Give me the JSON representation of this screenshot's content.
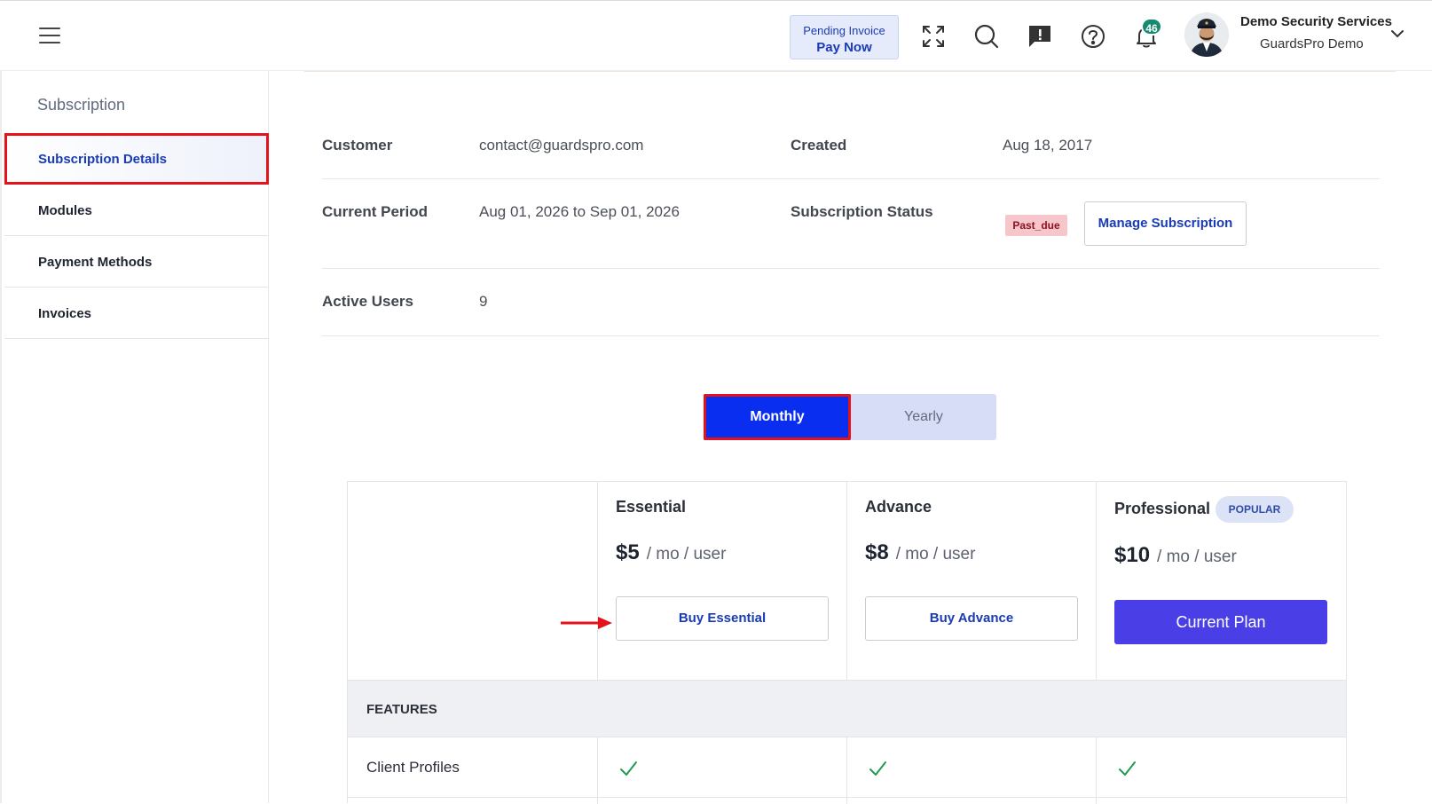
{
  "header": {
    "pending_line1": "Pending Invoice",
    "pending_line2": "Pay Now",
    "notification_count": "46",
    "org_name": "Demo Security Services",
    "user_name": "GuardsPro Demo",
    "icons": [
      "menu-icon",
      "expand-icon",
      "search-icon",
      "feedback-icon",
      "help-icon",
      "bell-icon",
      "avatar",
      "chevron-down-icon"
    ]
  },
  "sidebar": {
    "title": "Subscription",
    "items": [
      {
        "label": "Subscription Details",
        "active": true
      },
      {
        "label": "Modules"
      },
      {
        "label": "Payment Methods"
      },
      {
        "label": "Invoices"
      }
    ]
  },
  "details": {
    "customer_label": "Customer",
    "customer_value": "contact@guardspro.com",
    "created_label": "Created",
    "created_value": "Aug 18, 2017",
    "period_label": "Current Period",
    "period_value": "Aug 01, 2026 to Sep 01, 2026",
    "status_label": "Subscription Status",
    "status_value": "Past_due",
    "manage_label": "Manage Subscription",
    "users_label": "Active Users",
    "users_value": "9"
  },
  "billing_toggle": {
    "monthly": "Monthly",
    "yearly": "Yearly",
    "selected": "Monthly"
  },
  "plans": [
    {
      "name": "Essential",
      "price": "$5",
      "unit": "/ mo / user",
      "button": "Buy Essential"
    },
    {
      "name": "Advance",
      "price": "$8",
      "unit": "/ mo / user",
      "button": "Buy Advance"
    },
    {
      "name": "Professional",
      "badge": "POPULAR",
      "price": "$10",
      "unit": "/ mo / user",
      "button": "Current Plan"
    }
  ],
  "features": {
    "heading": "FEATURES",
    "rows": [
      {
        "name": "Client Profiles",
        "essential": true,
        "advance": true,
        "professional": true
      }
    ]
  },
  "colors": {
    "accent_blue": "#0a2ef0",
    "link_blue": "#1a3bb4",
    "current_plan": "#4a3fe6",
    "highlight_red": "#e3121b",
    "check_green": "#1f9a4e"
  }
}
